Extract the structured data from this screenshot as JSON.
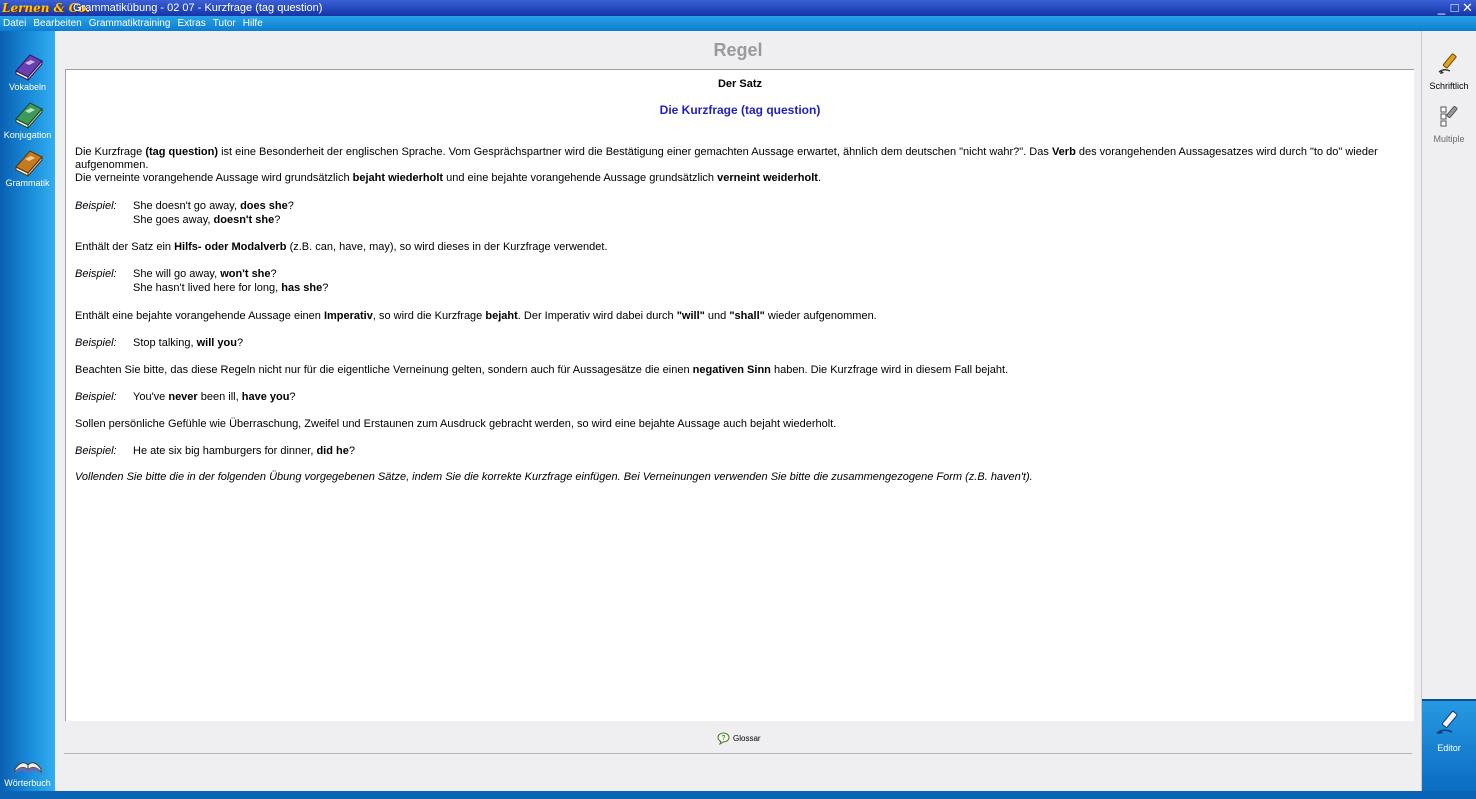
{
  "window": {
    "logo": "Lernen & Co.",
    "title": "Grammatikübung - 02 07 - Kurzfrage (tag question)",
    "controls": {
      "minimize": "_",
      "maximize": "□",
      "close": "✕"
    }
  },
  "menu": [
    "Datei",
    "Bearbeiten",
    "Grammatiktraining",
    "Extras",
    "Tutor",
    "Hilfe"
  ],
  "left_rail": [
    {
      "label": "Vokabeln",
      "icon": "purple-book-icon",
      "color": "#6a3fb0"
    },
    {
      "label": "Konjugation",
      "icon": "green-book-icon",
      "color": "#3f9a5a"
    },
    {
      "label": "Grammatik",
      "icon": "orange-book-icon",
      "color": "#c47a1e"
    },
    {
      "label": "Wörterbuch",
      "icon": "open-book-icon"
    }
  ],
  "right_rail": [
    {
      "label": "Schriftlich",
      "icon": "pen-icon"
    },
    {
      "label": "Multiple",
      "icon": "multiple-choice-icon"
    },
    {
      "label": "Editor",
      "icon": "editor-pen-icon"
    }
  ],
  "page_heading": "Regel",
  "content": {
    "section_title": "Der Satz",
    "rule_title": "Die Kurzfrage (tag question)",
    "p1": {
      "a": "Die Kurzfrage ",
      "b": "(tag question)",
      "c": " ist eine Besonderheit der englischen Sprache. Vom Gesprächspartner wird die Bestätigung einer gemachten Aussage erwartet, ähnlich dem deutschen \"nicht wahr?\". Das ",
      "d": "Verb",
      "e": " des vorangehenden Aussagesatzes wird durch \"to do\" wieder aufgenommen."
    },
    "p2": {
      "a": "Die verneinte vorangehende Aussage wird grundsätzlich ",
      "b": "bejaht wiederholt",
      "c": " und eine bejahte vorangehende Aussage grundsätzlich ",
      "d": "verneint weiderholt",
      "e": "."
    },
    "example_tag": "Beispiel:",
    "ex1": [
      {
        "a": "She doesn't go away, ",
        "b": "does she",
        "c": "?"
      },
      {
        "a": "She goes away, ",
        "b": "doesn't she",
        "c": "?"
      }
    ],
    "p3": {
      "a": "Enthält der Satz ein ",
      "b": "Hilfs- oder Modalverb",
      "c": " (z.B. can, have, may), so wird dieses in der Kurzfrage verwendet."
    },
    "ex2": [
      {
        "a": "She will go away, ",
        "b": "won't she",
        "c": "?"
      },
      {
        "a": "She hasn't lived here for long, ",
        "b": "has she",
        "c": "?"
      }
    ],
    "p4": {
      "a": "Enthält eine bejahte vorangehende Aussage einen ",
      "b": "Imperativ",
      "c": ", so wird die Kurzfrage ",
      "d": "bejaht",
      "e": ". Der Imperativ wird dabei durch ",
      "f": "\"will\"",
      "g": " und ",
      "h": "\"shall\"",
      "i": " wieder aufgenommen."
    },
    "ex3": {
      "a": "Stop talking, ",
      "b": "will you",
      "c": "?"
    },
    "p5": {
      "a": "Beachten Sie bitte, das diese Regeln nicht nur für die eigentliche Verneinung gelten, sondern auch für Aussagesätze die einen ",
      "b": "negativen Sinn",
      "c": " haben. Die Kurzfrage wird in diesem Fall bejaht."
    },
    "ex4": {
      "a": "You've ",
      "b": "never",
      "c": " been ill, ",
      "d": "have you",
      "e": "?"
    },
    "p6": "Sollen persönliche Gefühle wie Überraschung, Zweifel und Erstaunen zum Ausdruck gebracht werden, so wird eine bejahte Aussage auch bejaht wiederholt.",
    "ex5": {
      "a": "He ate six big hamburgers for dinner, ",
      "b": "did he",
      "c": "?"
    },
    "p7": "Vollenden Sie bitte die in der folgenden Übung vorgegebenen Sätze, indem Sie die korrekte Kurzfrage einfügen. Bei Verneinungen verwenden Sie bitte die zusammengezogene Form (z.B. haven't)."
  },
  "footer": {
    "glossar_label": "Glossar"
  }
}
